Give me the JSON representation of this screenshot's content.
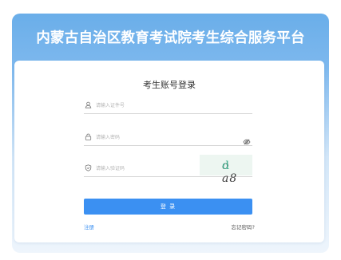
{
  "header": {
    "site_title": "内蒙古自治区教育考试院考生综合服务平台"
  },
  "login": {
    "title": "考生账号登录",
    "id_field": {
      "placeholder": "请输入证件号",
      "icon": "user-icon"
    },
    "password_field": {
      "placeholder": "请输入密码",
      "icon": "lock-icon",
      "toggle_icon": "eye-slash-icon"
    },
    "code_field": {
      "placeholder": "请输入验证码",
      "icon": "shield-icon"
    },
    "captcha_text": "o a8",
    "captcha_text_accent": "d",
    "submit_label": "登 录",
    "register_label": "注册",
    "forgot_label": "忘记密码?"
  },
  "colors": {
    "primary": "#3b90f2",
    "banner_top": "#6aaee9",
    "banner_bottom": "#eef5fc"
  }
}
